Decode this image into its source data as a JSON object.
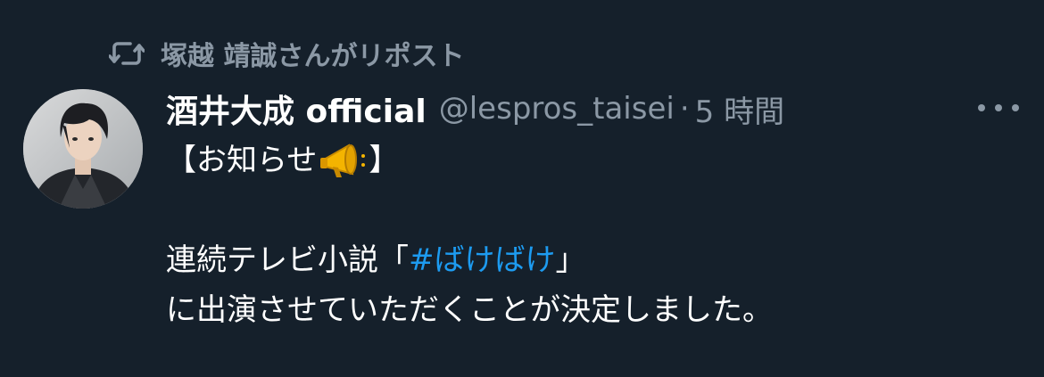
{
  "repost": {
    "icon": "repost-icon",
    "text": "塚越 靖誠さんがリポスト"
  },
  "tweet": {
    "display_name": "酒井大成 official",
    "handle": "@lespros_taisei",
    "separator": "·",
    "time": "5 時間",
    "body": {
      "line1_open": "【お知らせ",
      "line1_emoji": "megaphone-emoji",
      "line1_close": "】",
      "line2_prefix": "連続テレビ小説「",
      "hashtag": "#ばけばけ",
      "line2_suffix": "」",
      "line3": "に出演させていただくことが決定しました。"
    }
  },
  "colors": {
    "background": "#15202b",
    "secondary_text": "#8b98a5",
    "link": "#1d9bf0",
    "primary_text": "#ffffff"
  }
}
